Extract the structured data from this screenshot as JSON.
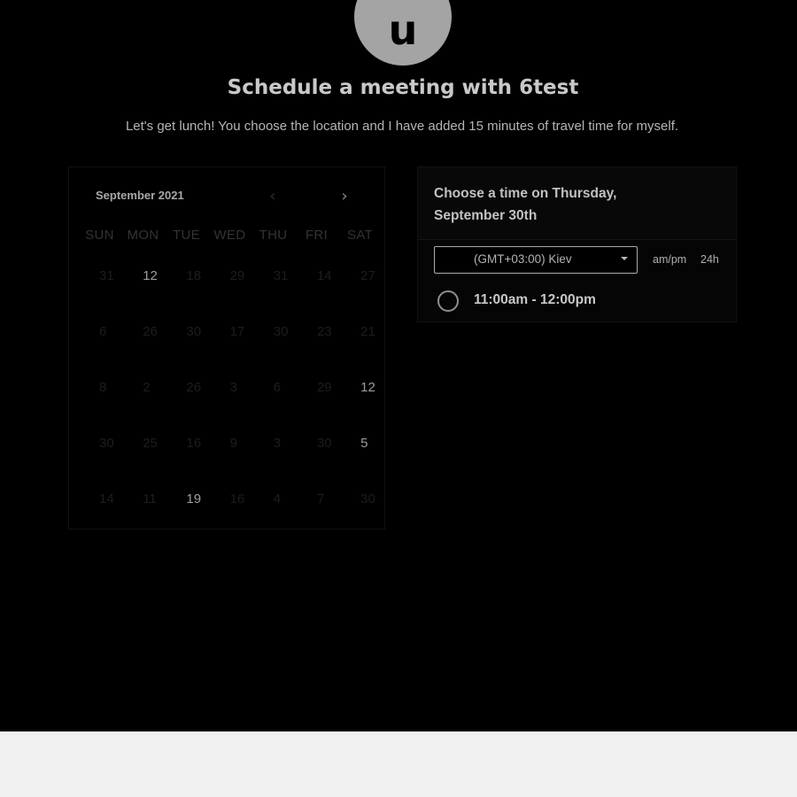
{
  "header": {
    "avatar_letter": "u",
    "title": "Schedule a meeting with 6test",
    "subtitle": "Let's get lunch! You choose the location and I have added 15 minutes of travel time for myself."
  },
  "calendar": {
    "month_label": "September 2021",
    "prev_icon": "chevron-left-icon",
    "next_icon": "chevron-right-icon",
    "weekdays": [
      "SUN",
      "MON",
      "TUE",
      "WED",
      "THU",
      "FRI",
      "SAT"
    ],
    "days": [
      {
        "n": "31",
        "active": false
      },
      {
        "n": "12",
        "active": true
      },
      {
        "n": "18",
        "active": false
      },
      {
        "n": "29",
        "active": false
      },
      {
        "n": "31",
        "active": false
      },
      {
        "n": "14",
        "active": false
      },
      {
        "n": "27",
        "active": false
      },
      {
        "n": "6",
        "active": false
      },
      {
        "n": "26",
        "active": false
      },
      {
        "n": "30",
        "active": false
      },
      {
        "n": "17",
        "active": false
      },
      {
        "n": "30",
        "active": false
      },
      {
        "n": "23",
        "active": false
      },
      {
        "n": "21",
        "active": false
      },
      {
        "n": "8",
        "active": false
      },
      {
        "n": "2",
        "active": false
      },
      {
        "n": "26",
        "active": false
      },
      {
        "n": "3",
        "active": false
      },
      {
        "n": "6",
        "active": false
      },
      {
        "n": "29",
        "active": false
      },
      {
        "n": "12",
        "active": true
      },
      {
        "n": "30",
        "active": false
      },
      {
        "n": "25",
        "active": false
      },
      {
        "n": "16",
        "active": false
      },
      {
        "n": "9",
        "active": false
      },
      {
        "n": "3",
        "active": false
      },
      {
        "n": "30",
        "active": false
      },
      {
        "n": "5",
        "active": true
      },
      {
        "n": "14",
        "active": false
      },
      {
        "n": "11",
        "active": false
      },
      {
        "n": "19",
        "active": true
      },
      {
        "n": "16",
        "active": false
      },
      {
        "n": "4",
        "active": false
      },
      {
        "n": "7",
        "active": false
      },
      {
        "n": "30",
        "active": false
      }
    ]
  },
  "time_picker": {
    "title_line1": "Choose a time on Thursday,",
    "title_line2": "September 30th",
    "timezone_value": "(GMT+03:00) Kiev",
    "format_ampm": "am/pm",
    "format_24h": "24h",
    "slots": [
      {
        "label": "11:00am - 12:00pm",
        "selected": false
      }
    ]
  }
}
